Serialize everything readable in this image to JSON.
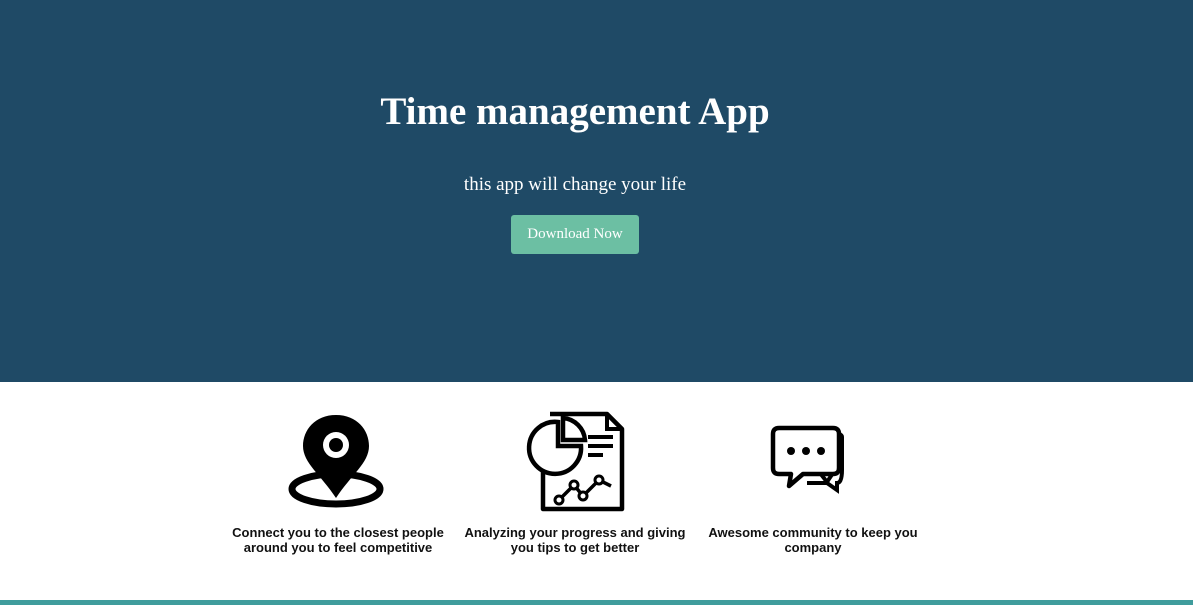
{
  "hero": {
    "title": "Time management App",
    "subtitle": "this app will change your life",
    "download_label": "Download Now",
    "background_color": "#1f4a66",
    "button_color": "#6cbfa3"
  },
  "features": [
    {
      "icon": "location-pin-icon",
      "text": "Connect you to the closest people around you to feel competitive"
    },
    {
      "icon": "report-chart-icon",
      "text": "Analyzing your progress and giving you tips to get better"
    },
    {
      "icon": "chat-bubbles-icon",
      "text": "Awesome community to keep you company"
    }
  ],
  "footer": {
    "accent_color": "#3f9c9c"
  }
}
